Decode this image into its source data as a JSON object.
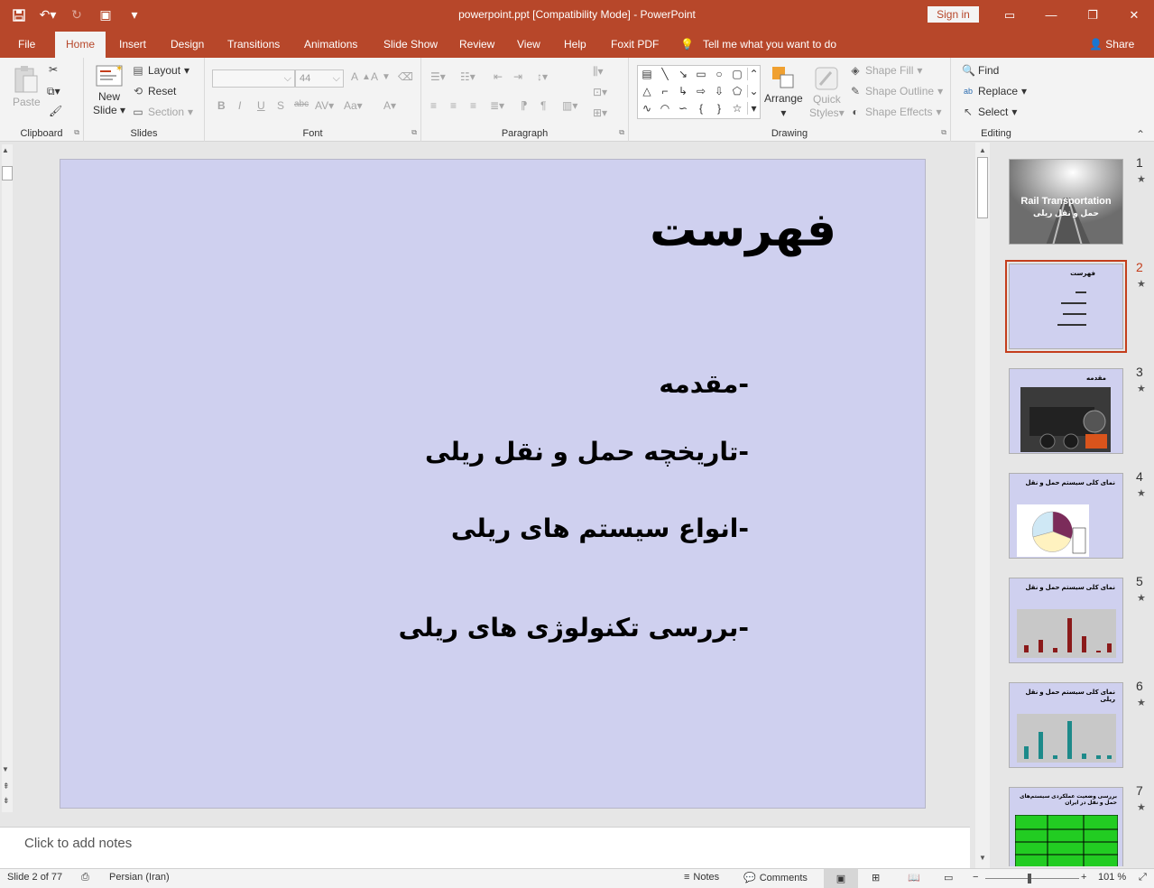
{
  "window": {
    "title": "powerpoint.ppt [Compatibility Mode]  -  PowerPoint",
    "sign_in": "Sign in"
  },
  "tabs": [
    {
      "label": "File"
    },
    {
      "label": "Home"
    },
    {
      "label": "Insert"
    },
    {
      "label": "Design"
    },
    {
      "label": "Transitions"
    },
    {
      "label": "Animations"
    },
    {
      "label": "Slide Show"
    },
    {
      "label": "Review"
    },
    {
      "label": "View"
    },
    {
      "label": "Help"
    },
    {
      "label": "Foxit PDF"
    }
  ],
  "tell_me": "Tell me what you want to do",
  "share": "Share",
  "ribbon": {
    "clipboard": {
      "label": "Clipboard",
      "paste": "Paste"
    },
    "slides": {
      "label": "Slides",
      "new_slide_1": "New",
      "new_slide_2": "Slide",
      "layout": "Layout",
      "reset": "Reset",
      "section": "Section"
    },
    "font": {
      "label": "Font",
      "size": "44"
    },
    "paragraph": {
      "label": "Paragraph"
    },
    "drawing": {
      "label": "Drawing",
      "arrange": "Arrange",
      "quick_1": "Quick",
      "quick_2": "Styles",
      "shape_fill": "Shape Fill",
      "shape_outline": "Shape Outline",
      "shape_effects": "Shape Effects"
    },
    "editing": {
      "label": "Editing",
      "find": "Find",
      "replace": "Replace",
      "select": "Select"
    }
  },
  "slide": {
    "title": "فهرست",
    "bullets": [
      "-مقدمه",
      "-تاریخچه حمل و نقل ریلی",
      "-انواع سیستم های ریلی",
      "-بررسی تکنولوژی های ریلی"
    ],
    "bg_color": "#cfd0ef"
  },
  "notes_placeholder": "Click to add notes",
  "thumbnails": [
    {
      "num": "1",
      "title_en": "Rail Transportation",
      "title_fa": "حمل و نقل ریلی"
    },
    {
      "num": "2",
      "title": "فهرست"
    },
    {
      "num": "3",
      "title": "مقدمه"
    },
    {
      "num": "4",
      "title": "نمای کلی سیستم حمل و نقل"
    },
    {
      "num": "5",
      "title": "نمای کلی سیستم حمل و نقل"
    },
    {
      "num": "6",
      "title": "نمای کلی سیستم حمل و نقل ریلی"
    },
    {
      "num": "7",
      "title": "بررسی وضعیت عملکردی سیستم‌های حمل و نقل در ایران"
    }
  ],
  "status": {
    "slide_info": "Slide 2 of 77",
    "language": "Persian (Iran)",
    "notes": "Notes",
    "comments": "Comments",
    "zoom": "101 %"
  },
  "colors": {
    "accent": "#b7472a",
    "selected_thumb": "#c43e1c"
  }
}
